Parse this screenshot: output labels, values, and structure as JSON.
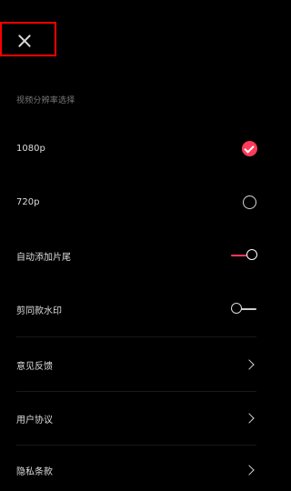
{
  "header": {
    "close_icon": "close-icon",
    "highlight_color": "#ff0000"
  },
  "resolution": {
    "section_title": "视频分辨率选择",
    "options": [
      {
        "label": "1080p",
        "selected": true
      },
      {
        "label": "720p",
        "selected": false
      }
    ]
  },
  "toggles": [
    {
      "label": "自动添加片尾",
      "on": true
    },
    {
      "label": "剪同款水印",
      "on": false
    }
  ],
  "links": [
    {
      "label": "意见反馈"
    },
    {
      "label": "用户协议"
    },
    {
      "label": "隐私条款"
    }
  ],
  "colors": {
    "accent": "#ff3a5a",
    "background": "#000000",
    "text": "#dedede",
    "muted": "#7a7a7a"
  }
}
